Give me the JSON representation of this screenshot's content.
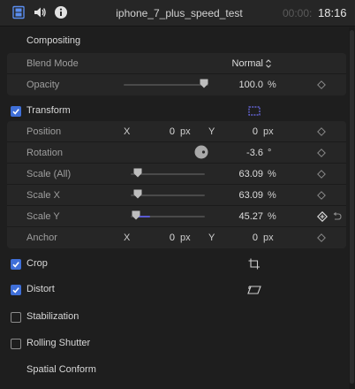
{
  "header": {
    "title": "iphone_7_plus_speed_test",
    "timecode_dim": "00:00:",
    "timecode_bright": "18:16",
    "icons": [
      "film-icon",
      "speaker-icon",
      "info-icon"
    ]
  },
  "compositing": {
    "label": "Compositing",
    "blend_mode": {
      "label": "Blend Mode",
      "value": "Normal"
    },
    "opacity": {
      "label": "Opacity",
      "value": "100.0",
      "unit": "%",
      "level": 1.0
    }
  },
  "transform": {
    "label": "Transform",
    "checked": true,
    "position": {
      "label": "Position",
      "x_axis": "X",
      "x_value": "0",
      "x_unit": "px",
      "y_axis": "Y",
      "y_value": "0",
      "y_unit": "px"
    },
    "rotation": {
      "label": "Rotation",
      "value": "-3.6",
      "unit": "°"
    },
    "scale_all": {
      "label": "Scale (All)",
      "value": "63.09",
      "unit": "%"
    },
    "scale_x": {
      "label": "Scale X",
      "value": "63.09",
      "unit": "%"
    },
    "scale_y": {
      "label": "Scale Y",
      "value": "45.27",
      "unit": "%"
    },
    "anchor": {
      "label": "Anchor",
      "x_axis": "X",
      "x_value": "0",
      "x_unit": "px",
      "y_axis": "Y",
      "y_value": "0",
      "y_unit": "px"
    }
  },
  "crop": {
    "label": "Crop",
    "checked": true
  },
  "distort": {
    "label": "Distort",
    "checked": true
  },
  "stabilization": {
    "label": "Stabilization",
    "checked": false
  },
  "rolling_shutter": {
    "label": "Rolling Shutter",
    "checked": false
  },
  "spatial_conform": {
    "label": "Spatial Conform"
  },
  "colors": {
    "accent": "#3f6fd8",
    "keyframe_active": "#5a5ad0"
  }
}
